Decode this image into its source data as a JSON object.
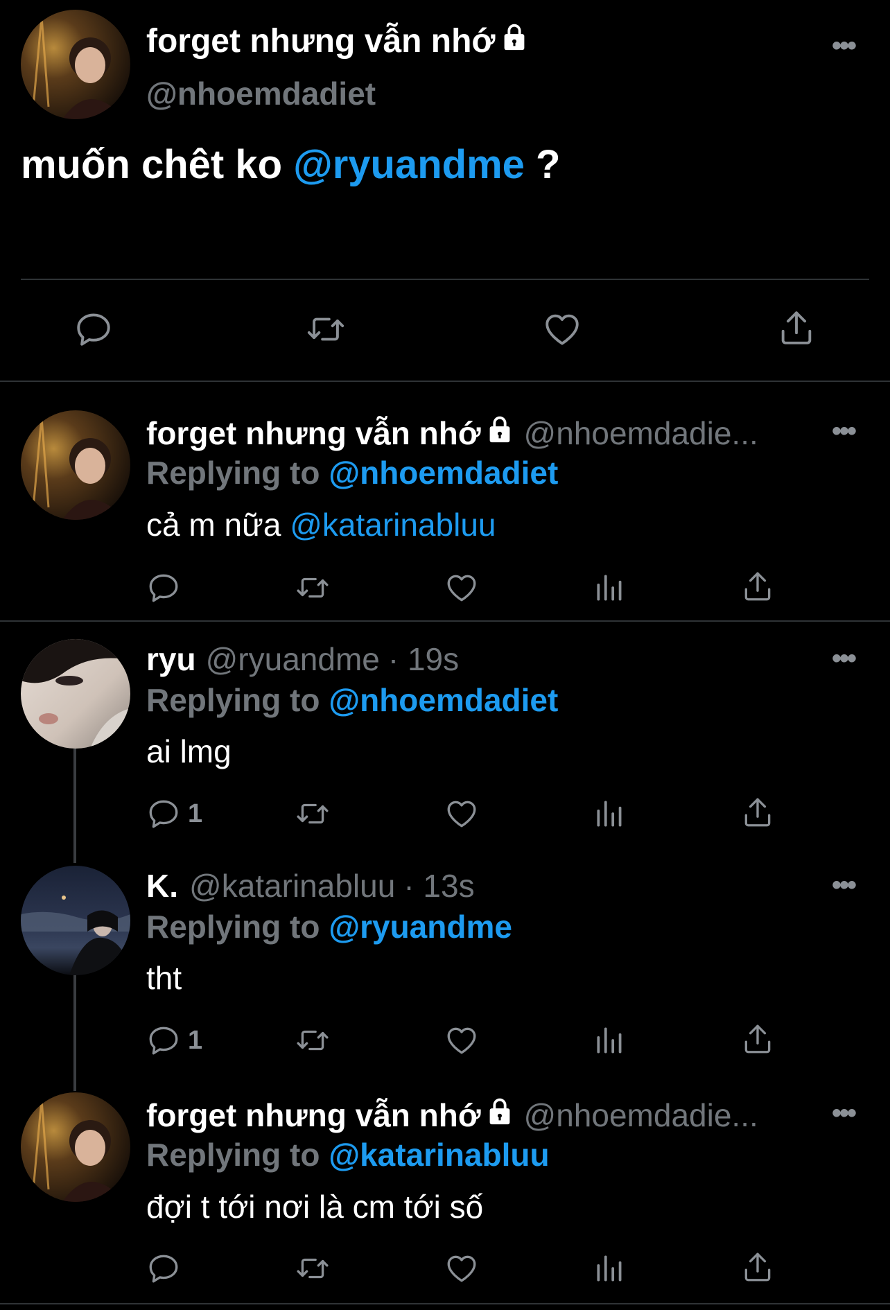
{
  "main_tweet": {
    "display_name": "forget nhưng vẫn nhớ",
    "handle": "@nhoemdadiet",
    "text_before": "muốn chêt ko ",
    "mention": "@ryuandme",
    "text_after": " ?"
  },
  "replies": [
    {
      "display_name": "forget nhưng vẫn nhớ",
      "handle": "@nhoemdadie...",
      "time": "",
      "locked": true,
      "replying_label": "Replying to",
      "replying_to": "@nhoemdadiet",
      "text": "cả m nữa ",
      "text_mention": "@katarinabluu",
      "reply_count": ""
    },
    {
      "display_name": "ryu",
      "handle": "@ryuandme",
      "time": "· 19s",
      "locked": false,
      "replying_label": "Replying to",
      "replying_to": "@nhoemdadiet",
      "text": "ai lmg",
      "text_mention": "",
      "reply_count": "1"
    },
    {
      "display_name": "K.",
      "handle": "@katarinabluu",
      "time": "· 13s",
      "locked": false,
      "replying_label": "Replying to",
      "replying_to": "@ryuandme",
      "text": "tht",
      "text_mention": "",
      "reply_count": "1"
    },
    {
      "display_name": "forget nhưng vẫn nhớ",
      "handle": "@nhoemdadie...",
      "time": "",
      "locked": true,
      "replying_label": "Replying to",
      "replying_to": "@katarinabluu",
      "text": "đợi t tới nơi là cm tới số",
      "text_mention": "",
      "reply_count": ""
    }
  ],
  "icons": {
    "more": "more-icon",
    "lock": "lock-icon",
    "reply": "reply-icon",
    "retweet": "retweet-icon",
    "like": "like-icon",
    "views": "views-icon",
    "share": "share-icon"
  },
  "colors": {
    "background": "#000000",
    "accent": "#1d9bf0",
    "secondary_text": "#71767b",
    "divider": "#2f3336"
  }
}
